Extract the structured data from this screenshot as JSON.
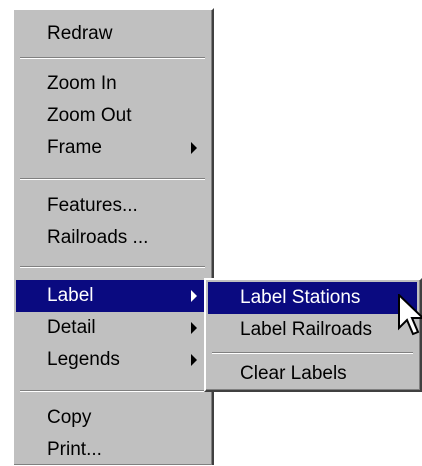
{
  "main_menu": {
    "items": [
      {
        "label": "Redraw"
      },
      {
        "label": "Zoom In"
      },
      {
        "label": "Zoom Out"
      },
      {
        "label": "Frame",
        "submenu": true
      },
      {
        "label": "Features..."
      },
      {
        "label": "Railroads ..."
      },
      {
        "label": "Label",
        "submenu": true,
        "highlighted": true
      },
      {
        "label": "Detail",
        "submenu": true
      },
      {
        "label": "Legends",
        "submenu": true
      },
      {
        "label": "Copy"
      },
      {
        "label": "Print..."
      }
    ]
  },
  "sub_menu": {
    "items": [
      {
        "label": "Label Stations",
        "highlighted": true
      },
      {
        "label": "Label Railroads"
      },
      {
        "label": "Clear Labels"
      }
    ]
  },
  "colors": {
    "menu_bg": "#c0c0c0",
    "highlight_bg": "#0a0a80",
    "highlight_text": "#ffffff"
  },
  "cursor_icon": "arrow-pointer-icon"
}
